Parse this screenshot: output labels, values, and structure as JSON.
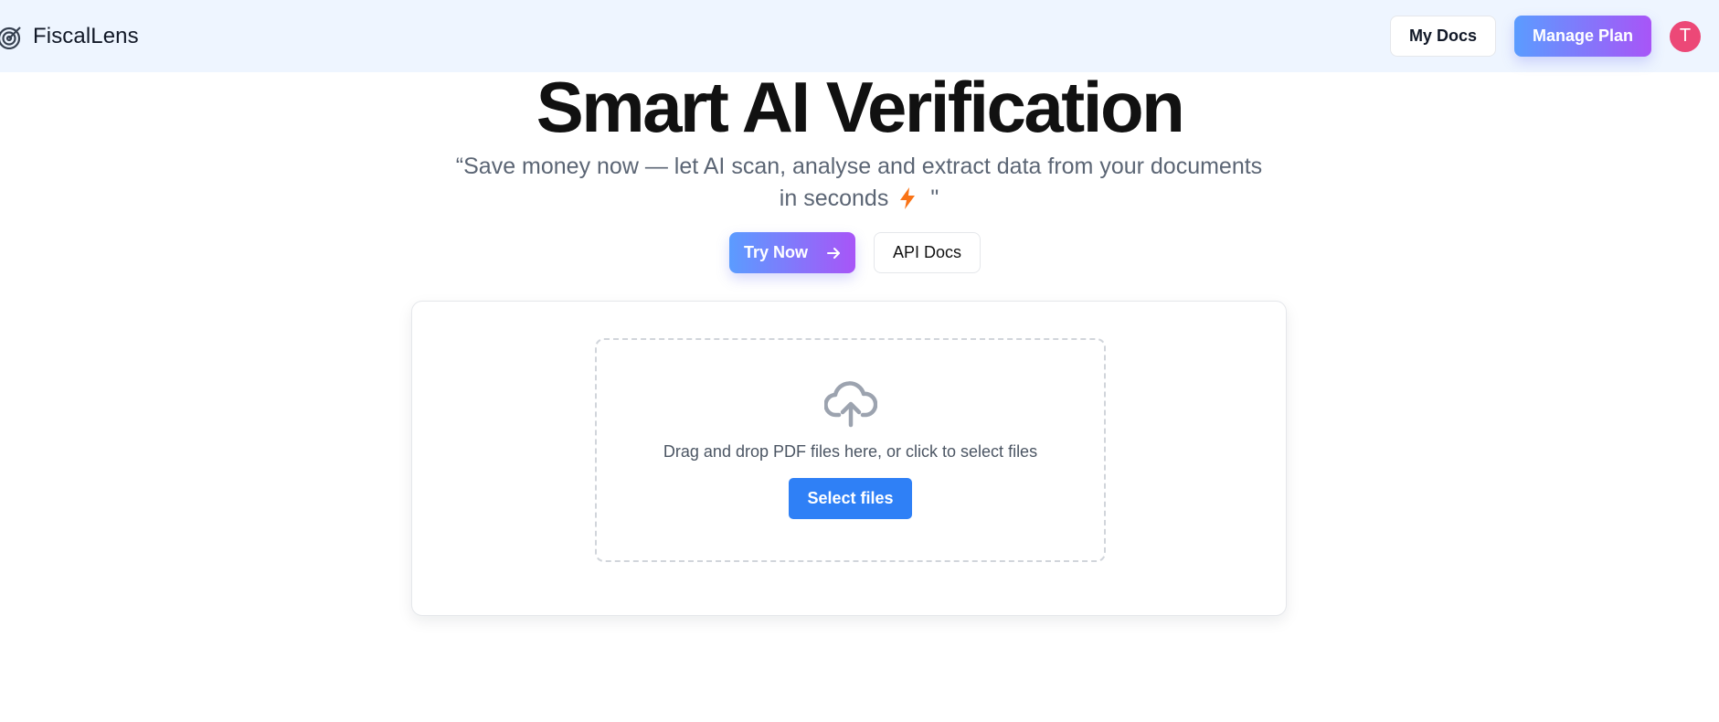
{
  "header": {
    "brand_name": "FiscalLens",
    "brand_icon": "radar-target-icon",
    "my_docs_label": "My Docs",
    "manage_plan_label": "Manage Plan",
    "avatar_initial": "T",
    "avatar_color": "#ec4877"
  },
  "hero": {
    "title": "Smart AI Verification",
    "subtitle_line1": "“Save money now — let AI scan, analyse and extract data from your documents",
    "subtitle_line2": "in seconds",
    "subtitle_end": "\"",
    "try_now_label": "Try Now",
    "api_docs_label": "API Docs"
  },
  "upload": {
    "icon": "cloud-upload-icon",
    "instructions": "Drag and drop PDF files here, or click to select files",
    "select_files_label": "Select files"
  },
  "colors": {
    "header_bg": "#eef5ff",
    "gradient_start": "#5b9cff",
    "gradient_end": "#a855f7",
    "primary_blue": "#2f80f6"
  }
}
